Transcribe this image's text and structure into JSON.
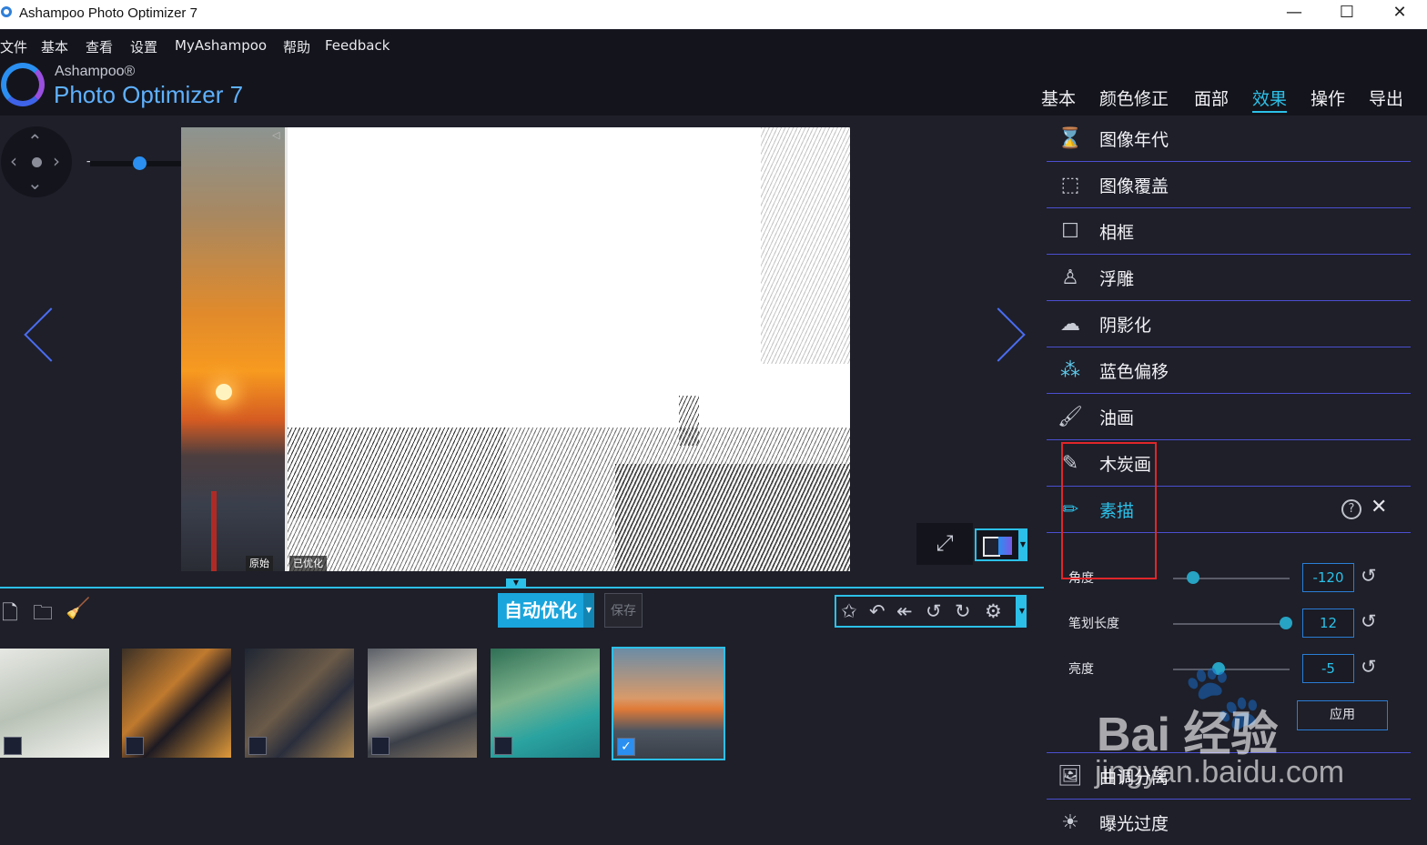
{
  "window": {
    "title": "Ashampoo Photo Optimizer 7",
    "minimize": "—",
    "maximize": "☐",
    "close": "✕"
  },
  "menu": [
    "文件",
    "基本",
    "查看",
    "设置",
    "MyAshampoo",
    "帮助",
    "Feedback"
  ],
  "brand": {
    "top": "Ashampoo®",
    "name": "Photo Optimizer 7"
  },
  "tabs": [
    {
      "label": "基本",
      "active": false
    },
    {
      "label": "颜色修正",
      "active": false
    },
    {
      "label": "面部",
      "active": false
    },
    {
      "label": "效果",
      "active": true
    },
    {
      "label": "操作",
      "active": false
    },
    {
      "label": "导出",
      "active": false
    }
  ],
  "viewer": {
    "zoom_minus": "−",
    "zoom_plus": "+",
    "zoom_level": 0.36,
    "label_original": "原始",
    "label_optimized": "已优化"
  },
  "toolbar": {
    "auto_optimize": "自动优化",
    "save": "保存"
  },
  "effects": [
    {
      "label": "图像年代",
      "icon": "hourglass-icon"
    },
    {
      "label": "图像覆盖",
      "icon": "image-overlay-icon"
    },
    {
      "label": "相框",
      "icon": "frame-icon"
    },
    {
      "label": "浮雕",
      "icon": "emboss-icon"
    },
    {
      "label": "阴影化",
      "icon": "cloud-shadow-icon"
    },
    {
      "label": "蓝色偏移",
      "icon": "color-dots-icon"
    },
    {
      "label": "油画",
      "icon": "brush-icon"
    },
    {
      "label": "木炭画",
      "icon": "charcoal-icon"
    },
    {
      "label": "素描",
      "icon": "pencil-icon",
      "active": true
    }
  ],
  "sketch_params": [
    {
      "label": "角度",
      "value": "-120",
      "slider": 0.17
    },
    {
      "label": "笔划长度",
      "value": "12",
      "slider": 0.97
    },
    {
      "label": "亮度",
      "value": "-5",
      "slider": 0.39
    }
  ],
  "apply": "应用",
  "effects_after": [
    {
      "label": "曲调分离",
      "icon": "image-icon"
    },
    {
      "label": "曝光过度",
      "icon": "sun-icon"
    }
  ],
  "watermark": {
    "baidu": "Bai 经验",
    "url": "jingyan.baidu.com"
  },
  "colors": {
    "accent": "#2cc0e8",
    "divider": "#4b4ed0",
    "highlight": "#e0262a"
  }
}
